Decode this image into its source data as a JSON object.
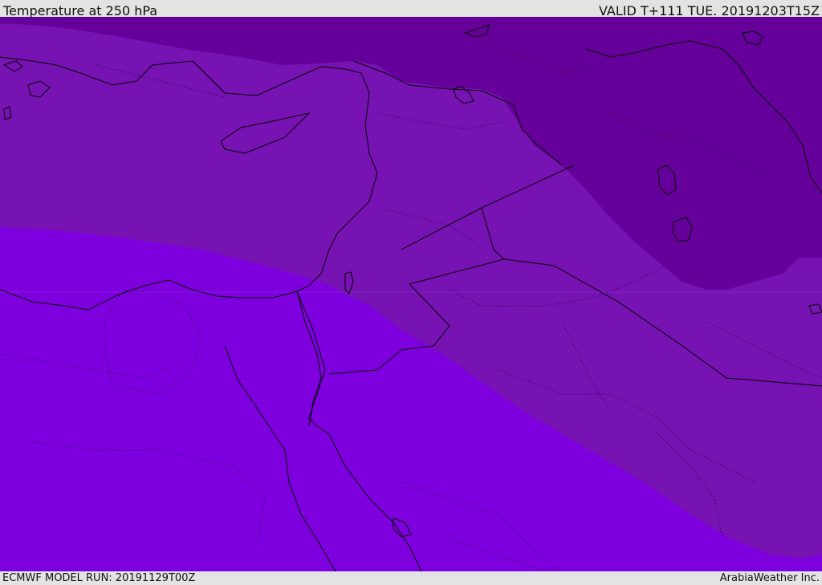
{
  "header": {
    "title": "Temperature at 250 hPa",
    "valid": "VALID T+111 TUE. 20191203T15Z"
  },
  "footer": {
    "model_run": "ECMWF MODEL RUN: 20191129T00Z",
    "credit": "ArabiaWeather Inc."
  },
  "map": {
    "colors": {
      "coldest": "#65009a",
      "cold": "#7712b3",
      "warm": "#7e00de",
      "coastline": "#000000",
      "border": "#000000"
    }
  }
}
